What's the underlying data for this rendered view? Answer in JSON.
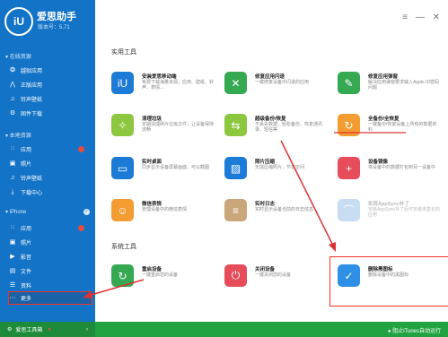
{
  "app": {
    "logo": "iU",
    "name": "爱思助手",
    "version": "版本号：5.71"
  },
  "sidebar": {
    "online": {
      "label": "在线资源",
      "items": [
        {
          "label": "越狱应用"
        },
        {
          "label": "正版应用"
        },
        {
          "label": "铃声壁纸"
        },
        {
          "label": "固件下载"
        }
      ]
    },
    "local": {
      "label": "本地资源",
      "items": [
        {
          "label": "应用"
        },
        {
          "label": "照片"
        },
        {
          "label": "铃声壁纸"
        },
        {
          "label": "下载中心"
        }
      ]
    },
    "device": {
      "label": "iPhone",
      "items": [
        {
          "label": "应用"
        },
        {
          "label": "照片"
        },
        {
          "label": "影音"
        },
        {
          "label": "文件"
        },
        {
          "label": "资料"
        },
        {
          "label": "更多"
        }
      ]
    },
    "footer": "爱思工具箱"
  },
  "main": {
    "section1": "实用工具",
    "section2": "系统工具",
    "tools": [
      {
        "title": "安装爱思移动端",
        "desc": "免费下载海量资源，应用、壁纸、铃声、表情...",
        "color": "#1c7bd6",
        "icon": "iU"
      },
      {
        "title": "修复应用闪退",
        "desc": "一键修复设备中闪退的应用",
        "color": "#35a852",
        "icon": "✕"
      },
      {
        "title": "修复应用弹窗",
        "desc": "解决应用弹窗要求输入Apple ID密码问题",
        "color": "#35a852",
        "icon": "✎"
      },
      {
        "title": "清理垃圾",
        "desc": "定期清理碎片垃圾文件，让设备保持流畅",
        "color": "#8dc63f",
        "icon": "✧"
      },
      {
        "title": "超级备份/恢复",
        "desc": "不丢失数据，轻松备份、恢复通讯录、短信等",
        "color": "#8dc63f",
        "icon": "⇆"
      },
      {
        "title": "全备份/全恢复",
        "desc": "一键备份/恢复设备上所有的数据资料",
        "color": "#f39c32",
        "icon": "↻"
      },
      {
        "title": "实时桌面",
        "desc": "同步显示设备屏幕画面，可以截图",
        "color": "#1c7bd6",
        "icon": "▭"
      },
      {
        "title": "照片压缩",
        "desc": "无损压缩照片，节省空间",
        "color": "#1c7bd6",
        "icon": "▨"
      },
      {
        "title": "设备镜像",
        "desc": "将设备中的数据打包到另一设备中",
        "color": "#e74c5a",
        "icon": "+"
      },
      {
        "title": "微信表情",
        "desc": "管理设备中的微信表情",
        "color": "#f39c32",
        "icon": "☺"
      },
      {
        "title": "实时日志",
        "desc": "实时显示设备当前的日志信息",
        "color": "#c9a77a",
        "icon": "≡"
      },
      {
        "title": "实现AppSync补丁",
        "desc": "安装AppSync补丁后可安装未签名的应用",
        "color": "#c8dcf2",
        "icon": "⌒"
      },
      {
        "title": "重启设备",
        "desc": "一键重启您的设备",
        "color": "#35a852",
        "icon": "↻"
      },
      {
        "title": "关闭设备",
        "desc": "一键关闭您的设备",
        "color": "#e74c5a",
        "icon": "⏻"
      },
      {
        "title": "删除黑图标",
        "desc": "删除设备中的黑图标",
        "color": "#2e8fe6",
        "icon": "✓"
      }
    ],
    "footer_stop": "阻止iTunes自动运行"
  },
  "window": {
    "controls": "≡ — ✕"
  }
}
